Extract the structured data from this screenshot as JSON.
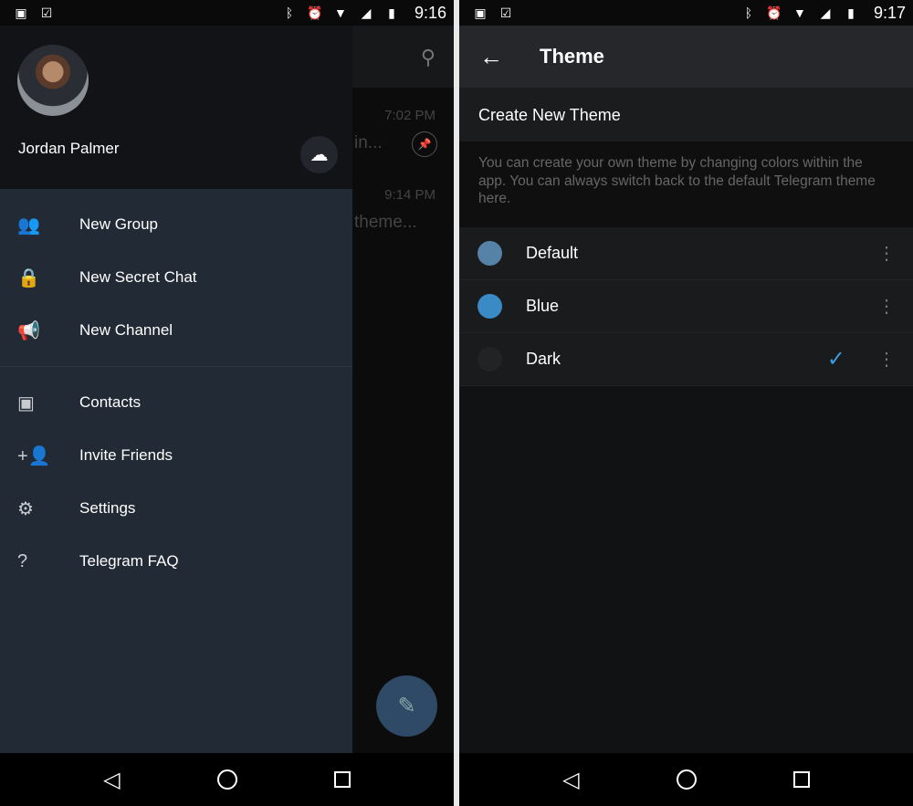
{
  "left": {
    "status": {
      "time": "9:16",
      "icons": [
        "image-icon",
        "clipboard-check-icon",
        "bluetooth-icon",
        "alarm-icon",
        "wifi-icon",
        "signal-icon",
        "battery-icon"
      ]
    },
    "chat_list": {
      "items": [
        {
          "time": "7:02 PM",
          "preview": "in..."
        },
        {
          "time": "9:14 PM",
          "preview": "theme..."
        }
      ]
    },
    "drawer": {
      "user_name": "Jordan Palmer",
      "menu": [
        {
          "label": "New Group",
          "icon": "group-icon"
        },
        {
          "label": "New Secret Chat",
          "icon": "lock-icon"
        },
        {
          "label": "New Channel",
          "icon": "megaphone-icon"
        },
        {
          "label": "Contacts",
          "icon": "contacts-icon"
        },
        {
          "label": "Invite Friends",
          "icon": "add-person-icon"
        },
        {
          "label": "Settings",
          "icon": "gear-icon"
        },
        {
          "label": "Telegram FAQ",
          "icon": "help-icon"
        }
      ]
    }
  },
  "right": {
    "status": {
      "time": "9:17"
    },
    "toolbar": {
      "title": "Theme"
    },
    "create_label": "Create New Theme",
    "info": "You can create your own theme by changing colors within the app. You can always switch back to the default Telegram theme here.",
    "themes": [
      {
        "name": "Default",
        "color": "#5682a8",
        "selected": false
      },
      {
        "name": "Blue",
        "color": "#3a8ac6",
        "selected": false
      },
      {
        "name": "Dark",
        "color": "#222325",
        "selected": true
      }
    ]
  },
  "colors": {
    "accent": "#3d9be0",
    "drawer_bg": "#222a35"
  }
}
